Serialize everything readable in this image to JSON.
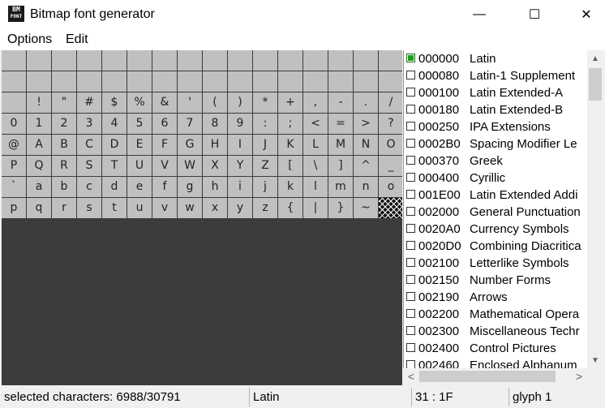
{
  "window": {
    "title": "Bitmap font generator",
    "icon_text_top": "BM",
    "icon_text_bottom": "FONT",
    "minimize": "—",
    "maximize": "☐",
    "close": "✕"
  },
  "menu": {
    "options": "Options",
    "edit": "Edit"
  },
  "grid": {
    "columns": 16,
    "light_color": "#c0c0c0",
    "dark_color": "#3c3c3c",
    "rows": [
      [
        "",
        "",
        "",
        "",
        "",
        "",
        "",
        "",
        "",
        "",
        "",
        "",
        "",
        "",
        "",
        ""
      ],
      [
        "",
        "",
        "",
        "",
        "",
        "",
        "",
        "",
        "",
        "",
        "",
        "",
        "",
        "",
        "",
        ""
      ],
      [
        "",
        "!",
        "\"",
        "#",
        "$",
        "%",
        "&",
        "'",
        "(",
        ")",
        "*",
        "+",
        ",",
        "-",
        ".",
        "/"
      ],
      [
        "0",
        "1",
        "2",
        "3",
        "4",
        "5",
        "6",
        "7",
        "8",
        "9",
        ":",
        ";",
        "<",
        "=",
        ">",
        "?"
      ],
      [
        "@",
        "A",
        "B",
        "C",
        "D",
        "E",
        "F",
        "G",
        "H",
        "I",
        "J",
        "K",
        "L",
        "M",
        "N",
        "O"
      ],
      [
        "P",
        "Q",
        "R",
        "S",
        "T",
        "U",
        "V",
        "W",
        "X",
        "Y",
        "Z",
        "[",
        "\\",
        "]",
        "^",
        "_"
      ],
      [
        "`",
        "a",
        "b",
        "c",
        "d",
        "e",
        "f",
        "g",
        "h",
        "i",
        "j",
        "k",
        "l",
        "m",
        "n",
        "o"
      ],
      [
        "p",
        "q",
        "r",
        "s",
        "t",
        "u",
        "v",
        "w",
        "x",
        "y",
        "z",
        "{",
        "|",
        "}",
        "~",
        ""
      ]
    ],
    "hatched_cell": "7,15",
    "dark_rows": 8
  },
  "ranges": [
    {
      "code": "000000",
      "name": "Latin",
      "checked": true
    },
    {
      "code": "000080",
      "name": "Latin-1 Supplement",
      "checked": false
    },
    {
      "code": "000100",
      "name": "Latin Extended-A",
      "checked": false
    },
    {
      "code": "000180",
      "name": "Latin Extended-B",
      "checked": false
    },
    {
      "code": "000250",
      "name": "IPA Extensions",
      "checked": false
    },
    {
      "code": "0002B0",
      "name": "Spacing Modifier Le",
      "checked": false
    },
    {
      "code": "000370",
      "name": "Greek",
      "checked": false
    },
    {
      "code": "000400",
      "name": "Cyrillic",
      "checked": false
    },
    {
      "code": "001E00",
      "name": "Latin Extended Addi",
      "checked": false
    },
    {
      "code": "002000",
      "name": "General Punctuation",
      "checked": false
    },
    {
      "code": "0020A0",
      "name": "Currency Symbols",
      "checked": false
    },
    {
      "code": "0020D0",
      "name": "Combining Diacritica",
      "checked": false
    },
    {
      "code": "002100",
      "name": "Letterlike Symbols",
      "checked": false
    },
    {
      "code": "002150",
      "name": "Number Forms",
      "checked": false
    },
    {
      "code": "002190",
      "name": "Arrows",
      "checked": false
    },
    {
      "code": "002200",
      "name": "Mathematical Opera",
      "checked": false
    },
    {
      "code": "002300",
      "name": "Miscellaneous Techr",
      "checked": false
    },
    {
      "code": "002400",
      "name": "Control Pictures",
      "checked": false
    },
    {
      "code": "002460",
      "name": "Enclosed Alphanum",
      "checked": false
    }
  ],
  "scroll": {
    "up": "▲",
    "down": "▼",
    "left": "<",
    "right": ">"
  },
  "status": {
    "selected": "selected characters: 6988/30791",
    "range": "Latin",
    "position": "31 : 1F",
    "glyph": "glyph 1"
  }
}
